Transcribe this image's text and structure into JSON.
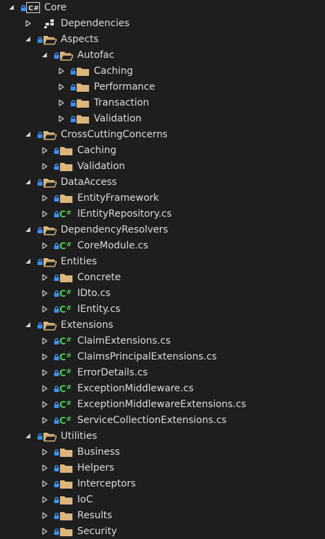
{
  "tree": {
    "rows": [
      {
        "label": "Core",
        "icon": "csharp-project-icon",
        "expander": "expanded",
        "lock": true,
        "indent": 0
      },
      {
        "label": "Dependencies",
        "icon": "dependencies-icon",
        "expander": "collapsed",
        "lock": false,
        "indent": 1
      },
      {
        "label": "Aspects",
        "icon": "folder-open-icon",
        "expander": "expanded",
        "lock": true,
        "indent": 1
      },
      {
        "label": "Autofac",
        "icon": "folder-open-icon",
        "expander": "expanded",
        "lock": true,
        "indent": 2
      },
      {
        "label": "Caching",
        "icon": "folder-icon",
        "expander": "collapsed",
        "lock": true,
        "indent": 3
      },
      {
        "label": "Performance",
        "icon": "folder-icon",
        "expander": "collapsed",
        "lock": true,
        "indent": 3
      },
      {
        "label": "Transaction",
        "icon": "folder-icon",
        "expander": "collapsed",
        "lock": true,
        "indent": 3
      },
      {
        "label": "Validation",
        "icon": "folder-icon",
        "expander": "collapsed",
        "lock": true,
        "indent": 3
      },
      {
        "label": "CrossCuttingConcerns",
        "icon": "folder-open-icon",
        "expander": "expanded",
        "lock": true,
        "indent": 1
      },
      {
        "label": "Caching",
        "icon": "folder-icon",
        "expander": "collapsed",
        "lock": true,
        "indent": 2
      },
      {
        "label": "Validation",
        "icon": "folder-icon",
        "expander": "collapsed",
        "lock": true,
        "indent": 2
      },
      {
        "label": "DataAccess",
        "icon": "folder-open-icon",
        "expander": "expanded",
        "lock": true,
        "indent": 1
      },
      {
        "label": "EntityFramework",
        "icon": "folder-icon",
        "expander": "collapsed",
        "lock": true,
        "indent": 2
      },
      {
        "label": "IEntityRepository.cs",
        "icon": "csharp-file-icon",
        "expander": "collapsed",
        "lock": true,
        "indent": 2
      },
      {
        "label": "DependencyResolvers",
        "icon": "folder-open-icon",
        "expander": "expanded",
        "lock": true,
        "indent": 1
      },
      {
        "label": "CoreModule.cs",
        "icon": "csharp-file-icon",
        "expander": "collapsed",
        "lock": true,
        "indent": 2
      },
      {
        "label": "Entities",
        "icon": "folder-open-icon",
        "expander": "expanded",
        "lock": true,
        "indent": 1
      },
      {
        "label": "Concrete",
        "icon": "folder-icon",
        "expander": "collapsed",
        "lock": true,
        "indent": 2
      },
      {
        "label": "IDto.cs",
        "icon": "csharp-file-icon",
        "expander": "collapsed",
        "lock": true,
        "indent": 2
      },
      {
        "label": "IEntity.cs",
        "icon": "csharp-file-icon",
        "expander": "collapsed",
        "lock": true,
        "indent": 2
      },
      {
        "label": "Extensions",
        "icon": "folder-open-icon",
        "expander": "expanded",
        "lock": true,
        "indent": 1
      },
      {
        "label": "ClaimExtensions.cs",
        "icon": "csharp-file-icon",
        "expander": "collapsed",
        "lock": true,
        "indent": 2
      },
      {
        "label": "ClaimsPrincipalExtensions.cs",
        "icon": "csharp-file-icon",
        "expander": "collapsed",
        "lock": true,
        "indent": 2
      },
      {
        "label": "ErrorDetails.cs",
        "icon": "csharp-file-icon",
        "expander": "collapsed",
        "lock": true,
        "indent": 2
      },
      {
        "label": "ExceptionMiddleware.cs",
        "icon": "csharp-file-icon",
        "expander": "collapsed",
        "lock": true,
        "indent": 2
      },
      {
        "label": "ExceptionMiddlewareExtensions.cs",
        "icon": "csharp-file-icon",
        "expander": "collapsed",
        "lock": true,
        "indent": 2
      },
      {
        "label": "ServiceCollectionExtensions.cs",
        "icon": "csharp-file-icon",
        "expander": "collapsed",
        "lock": true,
        "indent": 2
      },
      {
        "label": "Utilities",
        "icon": "folder-open-icon",
        "expander": "expanded",
        "lock": true,
        "indent": 1
      },
      {
        "label": "Business",
        "icon": "folder-icon",
        "expander": "collapsed",
        "lock": true,
        "indent": 2
      },
      {
        "label": "Helpers",
        "icon": "folder-icon",
        "expander": "collapsed",
        "lock": true,
        "indent": 2
      },
      {
        "label": "Interceptors",
        "icon": "folder-icon",
        "expander": "collapsed",
        "lock": true,
        "indent": 2
      },
      {
        "label": "IoC",
        "icon": "folder-icon",
        "expander": "collapsed",
        "lock": true,
        "indent": 2
      },
      {
        "label": "Results",
        "icon": "folder-icon",
        "expander": "collapsed",
        "lock": true,
        "indent": 2
      },
      {
        "label": "Security",
        "icon": "folder-icon",
        "expander": "collapsed",
        "lock": true,
        "indent": 2
      }
    ]
  },
  "colors": {
    "background": "#1e1e1e",
    "text": "#dcdcdc",
    "folder": "#dcb67a",
    "lock": "#3794ff",
    "csharp": "#4ec94e",
    "expander": "#d4d4d4"
  }
}
